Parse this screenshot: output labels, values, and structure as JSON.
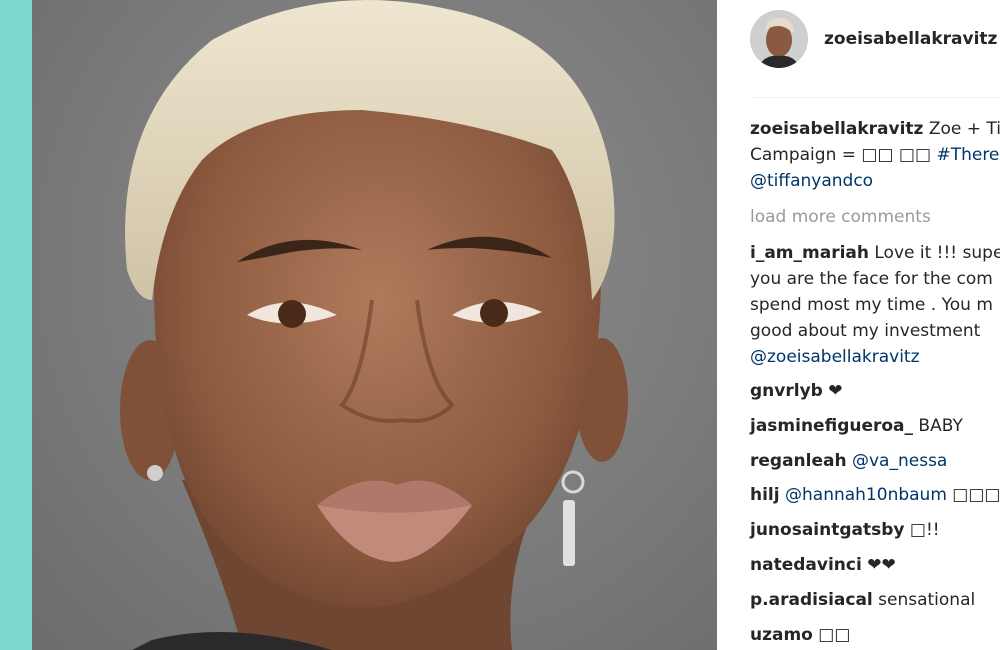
{
  "post": {
    "username": "zoeisabellakravitz",
    "caption_lines": [
      {
        "user": "zoeisabellakravitz",
        "text": " Zoe + Tif"
      },
      {
        "text": "Campaign = □□ □□ ",
        "tag": "#There"
      },
      {
        "mention": "@tiffanyandco"
      }
    ]
  },
  "load_more_label": "load more comments",
  "long_comment": {
    "user": "i_am_mariah",
    "lines": [
      " Love it !!! supe",
      "you are the face for the com",
      "spend most my time . You m",
      "good about my investment"
    ],
    "mention": "@zoeisabellakravitz"
  },
  "comments": [
    {
      "user": "gnvrlyb",
      "text": " ❤"
    },
    {
      "user": "jasminefigueroa_",
      "text": " BABY"
    },
    {
      "user": "reganleah",
      "text": " ",
      "mention": "@va_nessa"
    },
    {
      "user": "hilj",
      "text": " ",
      "mention": "@hannah10nbaum",
      "suffix": " □□□"
    },
    {
      "user": "junosaintgatsby",
      "text": " □!!"
    },
    {
      "user": "natedavinci",
      "text": " ❤❤"
    },
    {
      "user": "p.aradisiacal",
      "text": " sensational"
    },
    {
      "user": "uzamo",
      "text": " □□"
    }
  ],
  "colors": {
    "accent_bar": "#7fd8cf",
    "link": "#003569",
    "muted": "#999999",
    "text": "#262626"
  },
  "photo_subject": "portrait-photo"
}
